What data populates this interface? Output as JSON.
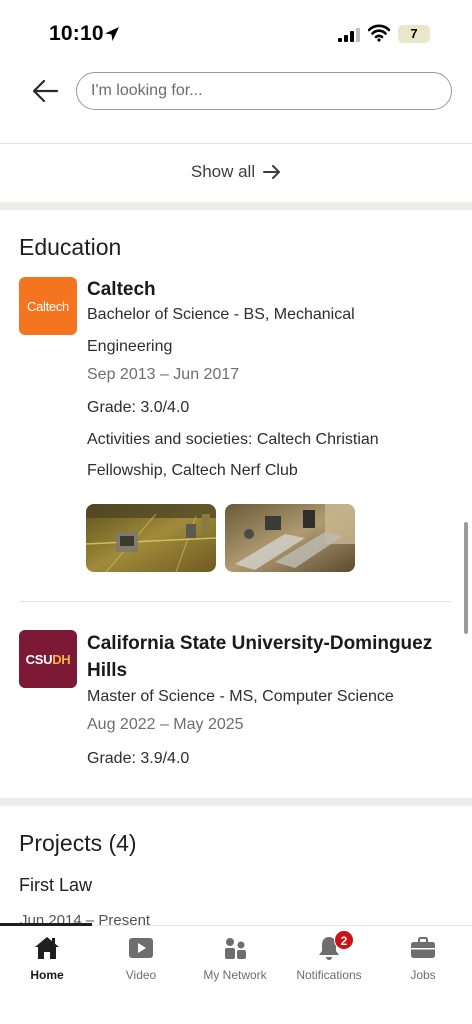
{
  "status_bar": {
    "time": "10:10",
    "battery": "7"
  },
  "search": {
    "placeholder": "I'm looking for..."
  },
  "show_all": {
    "label": "Show all"
  },
  "education": {
    "title": "Education",
    "schools": [
      {
        "logo_text": "Caltech",
        "name": "Caltech",
        "degree_line1": "Bachelor of Science - BS, Mechanical",
        "degree_line2": "Engineering",
        "dates": "Sep 2013 – Jun 2017",
        "grade": "Grade: 3.0/4.0",
        "activities_line1": "Activities and societies: Caltech Christian",
        "activities_line2": "Fellowship, Caltech Nerf Club"
      },
      {
        "logo_text_a": "CSU",
        "logo_text_b": "DH",
        "name_line1": "California State University-Dominguez",
        "name_line2": "Hills",
        "degree": "Master of Science - MS, Computer Science",
        "dates": "Aug 2022 – May 2025",
        "grade": "Grade: 3.9/4.0"
      }
    ]
  },
  "projects": {
    "title": "Projects (4)",
    "first_item": {
      "title": "First Law",
      "dates": "Jun 2014 – Present"
    }
  },
  "bottom_nav": {
    "items": [
      {
        "label": "Home",
        "icon": "home-icon",
        "active": true
      },
      {
        "label": "Video",
        "icon": "video-icon"
      },
      {
        "label": "My Network",
        "icon": "my-network-icon"
      },
      {
        "label": "Notifications",
        "icon": "bell-icon",
        "badge": "2"
      },
      {
        "label": "Jobs",
        "icon": "briefcase-icon"
      }
    ]
  },
  "colors": {
    "caltech_orange": "#f4741f",
    "csudh_maroon": "#7d1836",
    "badge_red": "#cc1016"
  }
}
